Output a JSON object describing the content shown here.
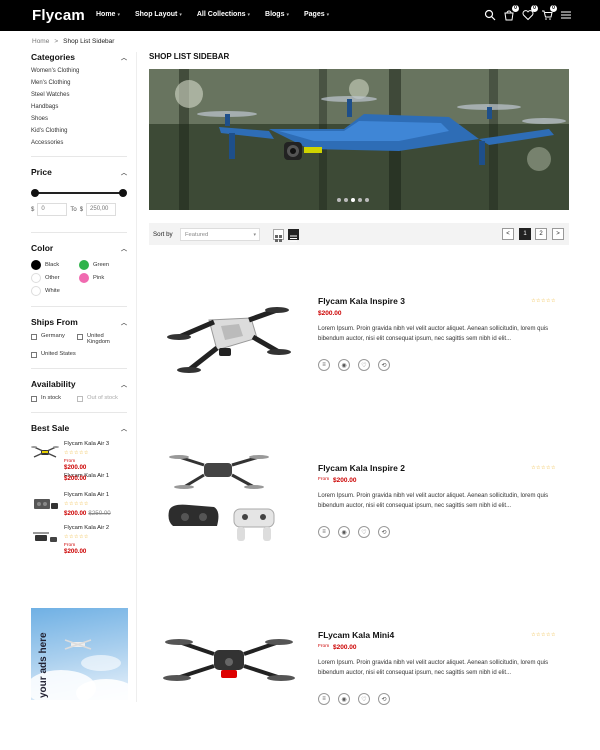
{
  "header": {
    "logo": "Flycam",
    "nav": [
      "Home",
      "Shop Layout",
      "All Collections",
      "Blogs",
      "Pages"
    ],
    "badges": {
      "compare": "0",
      "wishlist": "0",
      "cart": "0"
    }
  },
  "breadcrumb": {
    "home": "Home",
    "separator": ">",
    "current": "Shop List Sidebar"
  },
  "sidebar": {
    "categories": {
      "title": "Categories",
      "items": [
        "Women's Clothing",
        "Men's Clothing",
        "Steel Watches",
        "Handbags",
        "Shoes",
        "Kid's Clothing",
        "Accessories"
      ]
    },
    "price": {
      "title": "Price",
      "currency": "$",
      "min": "0",
      "to": "To",
      "max": "250,00",
      "range": [
        0,
        1
      ]
    },
    "color": {
      "title": "Color",
      "swatches": [
        {
          "label": "Black",
          "color": "#000000"
        },
        {
          "label": "Green",
          "color": "#2fb34a"
        },
        {
          "label": "Other",
          "color": "#ffffff"
        },
        {
          "label": "Pink",
          "color": "#f06ab0"
        },
        {
          "label": "White",
          "color": "#ffffff"
        }
      ]
    },
    "ships_from": {
      "title": "Ships From",
      "items": [
        "Germany",
        "United Kingdom",
        "United States"
      ]
    },
    "availability": {
      "title": "Availability",
      "items": [
        "In stock",
        "Out of stock"
      ]
    },
    "best_sale": {
      "title": "Best Sale",
      "items": [
        {
          "name": "Flycam Kala Air 3",
          "from": "From",
          "price": "$200.00",
          "old": ""
        },
        {
          "name": "Flycam Kala Air 1",
          "from": "",
          "price": "$200.00",
          "old": ""
        },
        {
          "name": "Flycam Kala Air 1",
          "from": "",
          "price": "$200.00",
          "old": "$250.00"
        },
        {
          "name": "Flycam Kala Air 2",
          "from": "From",
          "price": "$200.00",
          "old": ""
        }
      ]
    },
    "ad_text": "your ads here"
  },
  "main": {
    "title": "SHOP LIST SIDEBAR",
    "slider_dots": 5,
    "toolbar": {
      "sort_label": "Sort by",
      "sort_value": "Featured",
      "pages": [
        "1",
        "2"
      ],
      "prev": "<",
      "next": ">"
    },
    "products": [
      {
        "name": "Flycam Kala Inspire 3",
        "from": "",
        "price": "$200.00",
        "description": "Lorem Ipsum. Proin gravida nibh vel velit auctor aliquet. Aenean sollicitudin, lorem quis bibendum auctor, nisi elit consequat ipsum, nec sagittis sem nibh id elit..."
      },
      {
        "name": "Flycam Kala Inspire 2",
        "from": "From",
        "price": "$200.00",
        "description": "Lorem Ipsum. Proin gravida nibh vel velit auctor aliquet. Aenean sollicitudin, lorem quis bibendum auctor, nisi elit consequat ipsum, nec sagittis sem nibh id elit..."
      },
      {
        "name": "FLycam Kala Mini4",
        "from": "From",
        "price": "$200.00",
        "description": "Lorem Ipsum. Proin gravida nibh vel velit auctor aliquet. Aenean sollicitudin, lorem quis bibendum auctor, nisi elit consequat ipsum, nec sagittis sem nibh id elit..."
      }
    ],
    "rating_stars": "☆☆☆☆☆"
  },
  "colors": {
    "accent": "#cc0000",
    "header_bg": "#000000",
    "star": "#e8a400"
  }
}
